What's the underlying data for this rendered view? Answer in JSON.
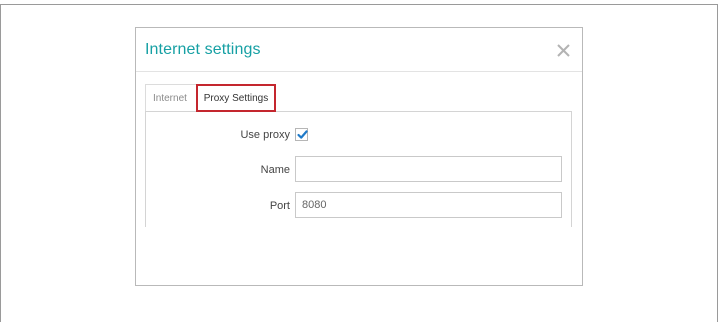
{
  "dialog": {
    "title": "Internet settings",
    "close_icon": "close-icon"
  },
  "tabs": [
    {
      "label": "Internet",
      "active": false
    },
    {
      "label": "Proxy Settings",
      "active": true
    }
  ],
  "form": {
    "use_proxy": {
      "label": "Use proxy",
      "checked": true
    },
    "name": {
      "label": "Name",
      "value": "",
      "placeholder": ""
    },
    "port": {
      "label": "Port",
      "value": "8080"
    }
  },
  "colors": {
    "title": "#16a0a4",
    "highlight_border": "#c4262e",
    "checkmark": "#1f7ac9"
  }
}
